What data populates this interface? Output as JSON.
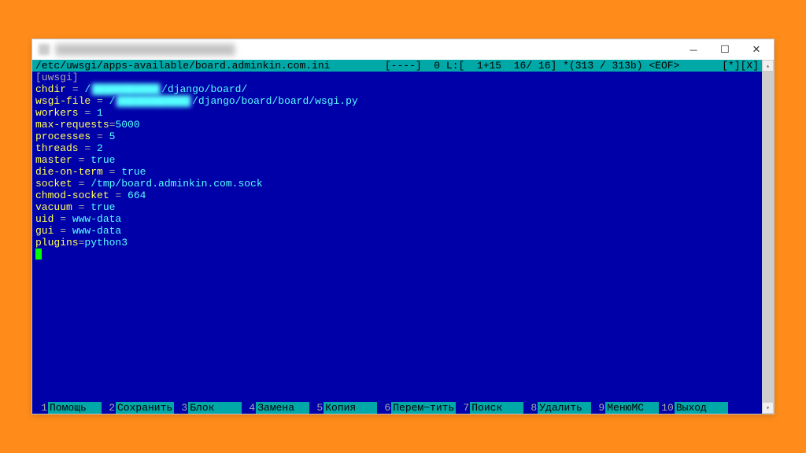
{
  "window": {
    "title": "████████████████████████"
  },
  "status": {
    "path": "/etc/uwsgi/apps-available/board.adminkin.com.ini",
    "info": "  [----]  0 L:[  1+15  16/ 16] *(313 / 313b) <EOF>",
    "right": "[*][X]"
  },
  "config": {
    "section": "[uwsgi]",
    "lines": [
      {
        "key": "chdir",
        "sep": " = ",
        "prefix": "/",
        "obscured": "███████████",
        "suffix": "/django/board/"
      },
      {
        "key": "wsgi-file",
        "sep": " = ",
        "prefix": "/",
        "obscured": "████████████",
        "suffix": "/django/board/board/wsgi.py"
      },
      {
        "key": "workers",
        "sep": " = ",
        "val": "1"
      },
      {
        "key": "max-requests",
        "sep": "=",
        "val": "5000"
      },
      {
        "key": "processes",
        "sep": " = ",
        "val": "5"
      },
      {
        "key": "threads",
        "sep": " = ",
        "val": "2"
      },
      {
        "key": "master",
        "sep": " = ",
        "val": "true"
      },
      {
        "key": "die-on-term",
        "sep": " = ",
        "val": "true"
      },
      {
        "key": "socket",
        "sep": " = ",
        "val": "/tmp/board.adminkin.com.sock"
      },
      {
        "key": "chmod-socket",
        "sep": " = ",
        "val": "664"
      },
      {
        "key": "vacuum",
        "sep": " = ",
        "val": "true"
      },
      {
        "key": "uid",
        "sep": " = ",
        "val": "www-data"
      },
      {
        "key": "gui",
        "sep": " = ",
        "val": "www-data"
      },
      {
        "key": "plugins",
        "sep": "=",
        "val": "python3"
      }
    ]
  },
  "fkeys": [
    {
      "n": "1",
      "label": "Помощь"
    },
    {
      "n": "2",
      "label": "Сохранить"
    },
    {
      "n": "3",
      "label": "Блок"
    },
    {
      "n": "4",
      "label": "Замена"
    },
    {
      "n": "5",
      "label": "Копия"
    },
    {
      "n": "6",
      "label": "Перем~тить"
    },
    {
      "n": "7",
      "label": "Поиск"
    },
    {
      "n": "8",
      "label": "Удалить"
    },
    {
      "n": "9",
      "label": "МенюMC"
    },
    {
      "n": "10",
      "label": "Выход"
    }
  ]
}
